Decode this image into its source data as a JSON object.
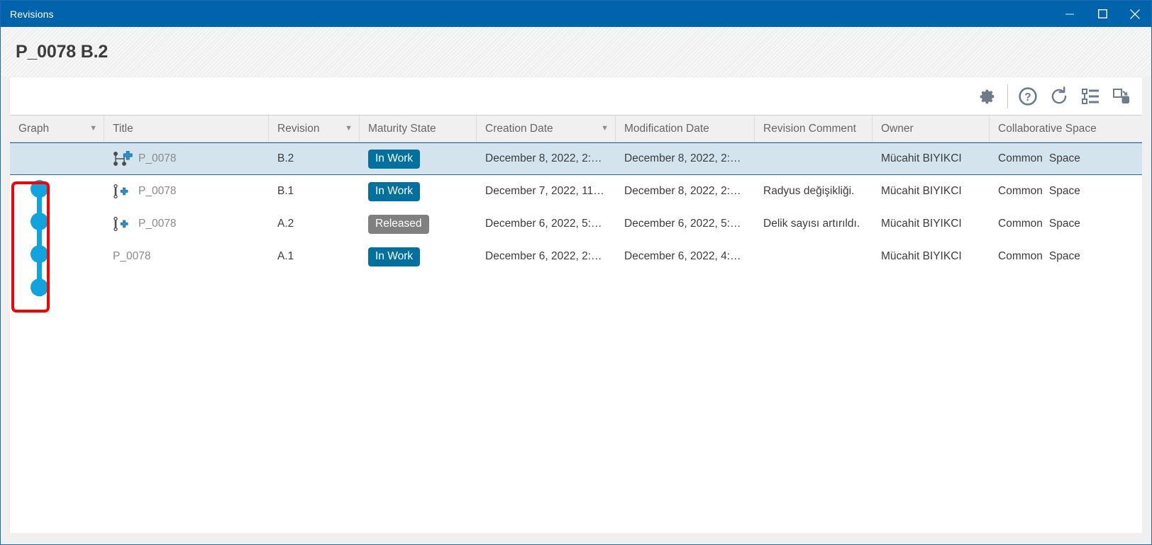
{
  "window": {
    "title": "Revisions",
    "controls": [
      {
        "name": "minimize-button",
        "glyph": "minimize"
      },
      {
        "name": "maximize-button",
        "glyph": "maximize"
      },
      {
        "name": "close-button",
        "glyph": "close"
      }
    ]
  },
  "header": {
    "page_title": "P_0078 B.2"
  },
  "toolbar": {
    "items": [
      {
        "name": "settings-icon",
        "label": "Settings"
      },
      {
        "name": "help-icon",
        "label": "Help"
      },
      {
        "name": "refresh-icon",
        "label": "Refresh"
      },
      {
        "name": "tree-list-icon",
        "label": "Show structure"
      },
      {
        "name": "restore-down-icon",
        "label": "Restore down"
      }
    ]
  },
  "table": {
    "columns": [
      {
        "key": "graph",
        "label": "Graph",
        "sortable": true
      },
      {
        "key": "title",
        "label": "Title",
        "sortable": false
      },
      {
        "key": "revision",
        "label": "Revision",
        "sortable": true
      },
      {
        "key": "maturity",
        "label": "Maturity State",
        "sortable": false
      },
      {
        "key": "creation",
        "label": "Creation Date",
        "sortable": true
      },
      {
        "key": "modification",
        "label": "Modification Date",
        "sortable": false
      },
      {
        "key": "comment",
        "label": "Revision Comment",
        "sortable": false
      },
      {
        "key": "owner",
        "label": "Owner",
        "sortable": false
      },
      {
        "key": "collaborative",
        "label": "Collaborative Space",
        "sortable": false
      }
    ],
    "sort_caret": "▼",
    "rows": [
      {
        "selected": true,
        "title_icon": "branch-add-icon",
        "title": "P_0078",
        "title_muted": true,
        "revision": "B.2",
        "maturity": "In Work",
        "maturity_style": "inwork",
        "creation": "December 8, 2022, 2:…",
        "modification": "December 8, 2022, 2:…",
        "comment": "",
        "owner": "Mücahit BIYIKCI",
        "collaborative_a": "Common",
        "collaborative_b": "Space"
      },
      {
        "selected": false,
        "title_icon": "revision-add-icon",
        "title": "P_0078",
        "title_muted": true,
        "revision": "B.1",
        "maturity": "In Work",
        "maturity_style": "inwork",
        "creation": "December 7, 2022, 11…",
        "modification": "December 8, 2022, 2:…",
        "comment": "Radyus değişikliği.",
        "owner": "Mücahit BIYIKCI",
        "collaborative_a": "Common",
        "collaborative_b": "Space"
      },
      {
        "selected": false,
        "title_icon": "revision-add-icon",
        "title": "P_0078",
        "title_muted": true,
        "revision": "A.2",
        "maturity": "Released",
        "maturity_style": "released",
        "creation": "December 6, 2022, 5:…",
        "modification": "December 6, 2022, 5:…",
        "comment": "Delik sayısı artırıldı.",
        "owner": "Mücahit BIYIKCI",
        "collaborative_a": "Common",
        "collaborative_b": "Space"
      },
      {
        "selected": false,
        "title_icon": "none",
        "title": "P_0078",
        "title_muted": true,
        "revision": "A.1",
        "maturity": "In Work",
        "maturity_style": "inwork",
        "creation": "December 6, 2022, 2:…",
        "modification": "December 6, 2022, 4:…",
        "comment": "",
        "owner": "Mücahit BIYIKCI",
        "collaborative_a": "Common",
        "collaborative_b": "Space"
      }
    ]
  },
  "graph": {
    "node_count": 4,
    "node_color": "#11a3dd",
    "highlight_color": "#fb0000"
  },
  "colors": {
    "titlebar": "#0063ab",
    "selected_row": "#d3e4ef",
    "badge_inwork": "#00709e",
    "badge_released": "#808080"
  }
}
